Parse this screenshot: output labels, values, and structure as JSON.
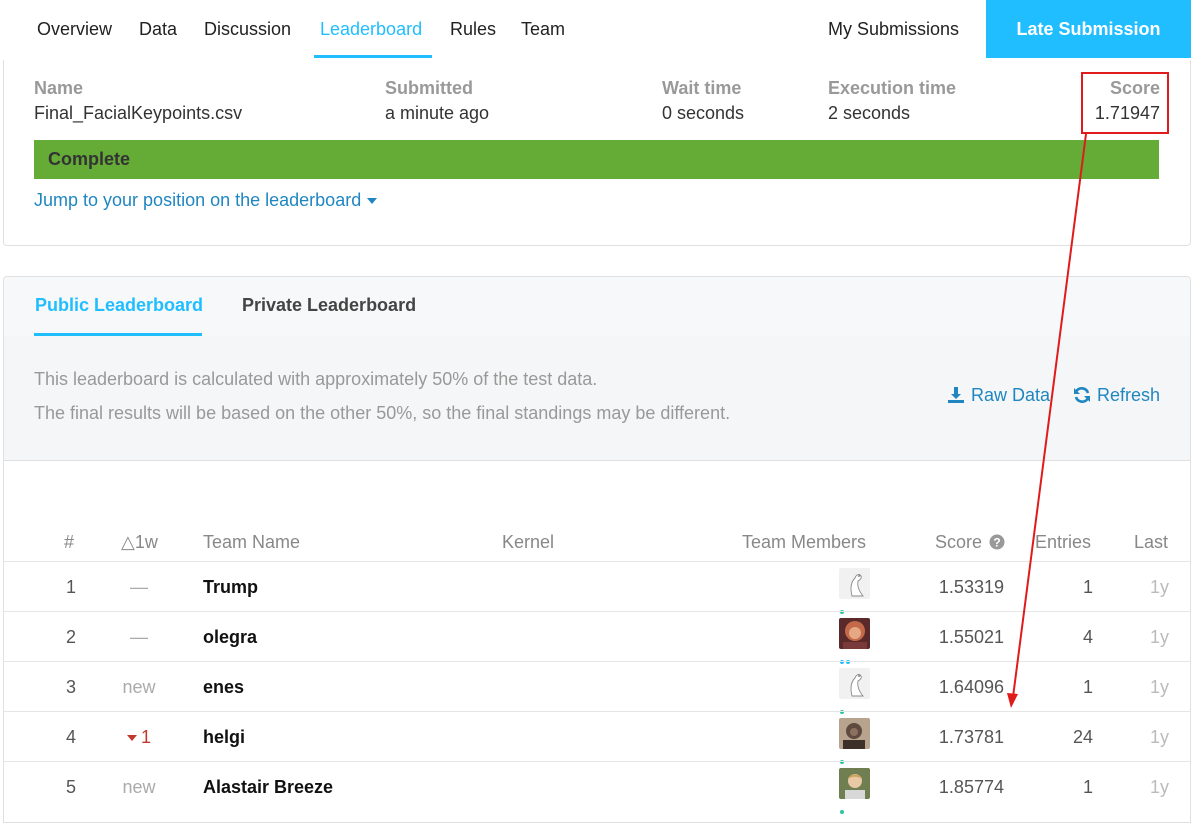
{
  "nav": {
    "tabs": [
      {
        "label": "Overview"
      },
      {
        "label": "Data"
      },
      {
        "label": "Discussion"
      },
      {
        "label": "Leaderboard"
      },
      {
        "label": "Rules"
      },
      {
        "label": "Team"
      }
    ],
    "active_tab": "Leaderboard",
    "my_submissions": "My Submissions",
    "late_submission": "Late Submission"
  },
  "submission": {
    "name_label": "Name",
    "name_value": "Final_FacialKeypoints.csv",
    "submitted_label": "Submitted",
    "submitted_value": "a minute ago",
    "wait_label": "Wait time",
    "wait_value": "0 seconds",
    "exec_label": "Execution time",
    "exec_value": "2 seconds",
    "score_label": "Score",
    "score_value": "1.71947",
    "status": "Complete",
    "jump_link": "Jump to your position on the leaderboard"
  },
  "leaderboard": {
    "tabs": [
      {
        "label": "Public Leaderboard"
      },
      {
        "label": "Private Leaderboard"
      }
    ],
    "info_line1": "This leaderboard is calculated with approximately 50% of the test data.",
    "info_line2": "The final results will be based on the other 50%, so the final standings may be different.",
    "raw_data": "Raw Data",
    "refresh": "Refresh",
    "columns": {
      "rank": "#",
      "change": "△1w",
      "team": "Team Name",
      "kernel": "Kernel",
      "members": "Team Members",
      "score": "Score",
      "entries": "Entries",
      "last": "Last"
    },
    "rows": [
      {
        "rank": "1",
        "change": "—",
        "team": "Trump",
        "score": "1.53319",
        "entries": "1",
        "last": "1y"
      },
      {
        "rank": "2",
        "change": "—",
        "team": "olegra",
        "score": "1.55021",
        "entries": "4",
        "last": "1y"
      },
      {
        "rank": "3",
        "change": "new",
        "team": "enes",
        "score": "1.64096",
        "entries": "1",
        "last": "1y"
      },
      {
        "rank": "4",
        "change": "1",
        "team": "helgi",
        "score": "1.73781",
        "entries": "24",
        "last": "1y"
      },
      {
        "rank": "5",
        "change": "new",
        "team": "Alastair Breeze",
        "score": "1.85774",
        "entries": "1",
        "last": "1y"
      }
    ]
  },
  "colors": {
    "accent": "#20beff",
    "status_complete": "#64ac36",
    "link": "#1f86c1",
    "annotation": "#e01b1b",
    "rank_down": "#c0392b"
  }
}
